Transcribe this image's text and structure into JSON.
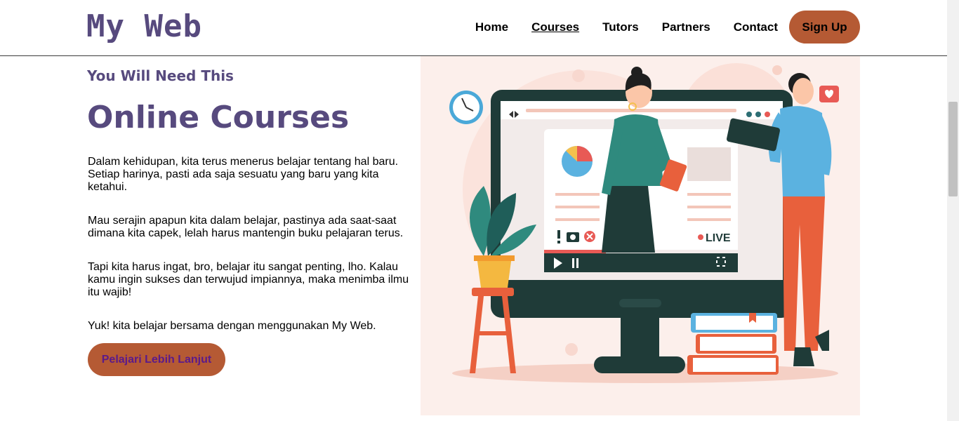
{
  "header": {
    "logo": "My Web",
    "nav": [
      {
        "label": "Home",
        "active": false
      },
      {
        "label": "Courses",
        "active": true
      },
      {
        "label": "Tutors",
        "active": false
      },
      {
        "label": "Partners",
        "active": false
      },
      {
        "label": "Contact",
        "active": false
      }
    ],
    "signup_label": "Sign Up"
  },
  "main": {
    "eyebrow": "You Will Need This",
    "title": "Online Courses",
    "paragraphs": [
      "Dalam kehidupan, kita terus menerus belajar tentang hal baru. Setiap harinya, pasti ada saja sesuatu yang baru yang kita ketahui.",
      "Mau serajin apapun kita dalam belajar, pastinya ada saat-saat dimana kita capek, lelah harus mantengin buku pelajaran terus.",
      "Tapi kita harus ingat, bro, belajar itu sangat penting, lho. Kalau kamu ingin sukses dan terwujud impiannya, maka menimba ilmu itu wajib!",
      "Yuk! kita belajar bersama dengan menggunakan My Web."
    ],
    "cta_label": "Pelajari Lebih Lanjut"
  },
  "illustration": {
    "live_label": "LIVE"
  },
  "colors": {
    "brand_purple": "#574a7e",
    "button_orange": "#b55a34",
    "cta_text": "#5b1a8a",
    "hero_bg": "#fcefeb"
  }
}
